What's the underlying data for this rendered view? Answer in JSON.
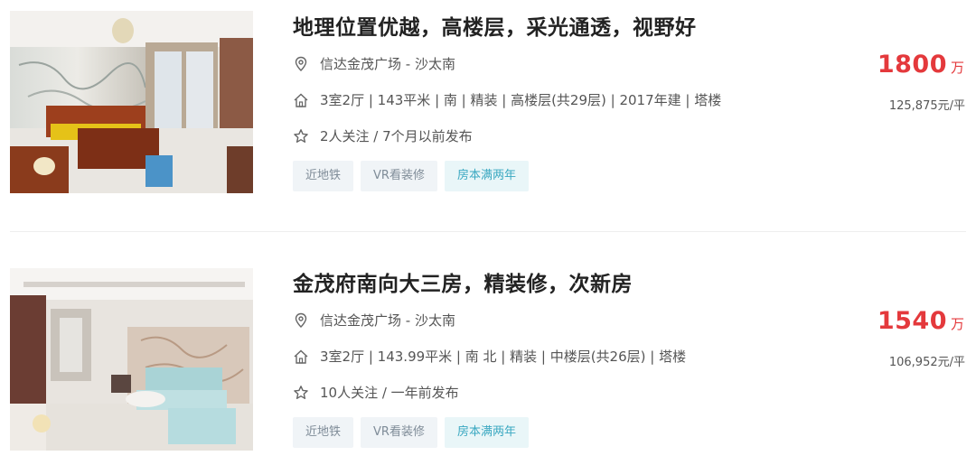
{
  "listings": [
    {
      "title": "地理位置优越，高楼层，采光通透，视野好",
      "location": "信达金茂广场 - 沙太南",
      "info": "3室2厅 | 143平米 | 南 | 精装 | 高楼层(共29层) | 2017年建 | 塔楼",
      "follow": "2人关注 / 7个月以前发布",
      "tags": [
        "近地铁",
        "VR看装修",
        "房本满两年"
      ],
      "price": "1800",
      "price_unit": "万",
      "unit_price": "125,875元/平"
    },
    {
      "title": "金茂府南向大三房，精装修，次新房",
      "location": "信达金茂广场 - 沙太南",
      "info": "3室2厅 | 143.99平米 | 南 北 | 精装 | 中楼层(共26层) | 塔楼",
      "follow": "10人关注 / 一年前发布",
      "tags": [
        "近地铁",
        "VR看装修",
        "房本满两年"
      ],
      "price": "1540",
      "price_unit": "万",
      "unit_price": "106,952元/平"
    }
  ],
  "icons": {
    "location": "location-pin-icon",
    "house": "house-icon",
    "star": "star-icon"
  },
  "colors": {
    "price": "#e4393c",
    "tag_bg": "#f0f4f7",
    "tag_highlight_bg": "#e9f6f8",
    "tag_highlight_text": "#3aa8c1"
  }
}
